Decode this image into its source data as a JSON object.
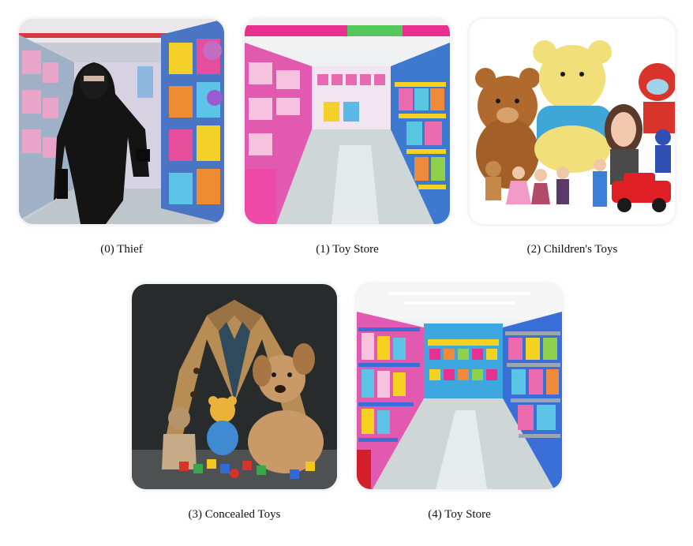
{
  "images": [
    {
      "caption": "(0) Thief",
      "scene": "thief-in-toy-store"
    },
    {
      "caption": "(1) Toy Store",
      "scene": "toy-store-aisle"
    },
    {
      "caption": "(2) Children's Toys",
      "scene": "childrens-toys"
    },
    {
      "caption": "(3) Concealed Toys",
      "scene": "coat-with-toys"
    },
    {
      "caption": "(4) Toy Store",
      "scene": "toy-store-aisle-wide"
    }
  ],
  "colors": {
    "shelf_blue": "#3a6fd8",
    "shelf_yellow": "#f4d21f",
    "shelf_pink": "#e93a9a",
    "floor": "#cfd6d8",
    "ceiling": "#f3f3f3"
  }
}
